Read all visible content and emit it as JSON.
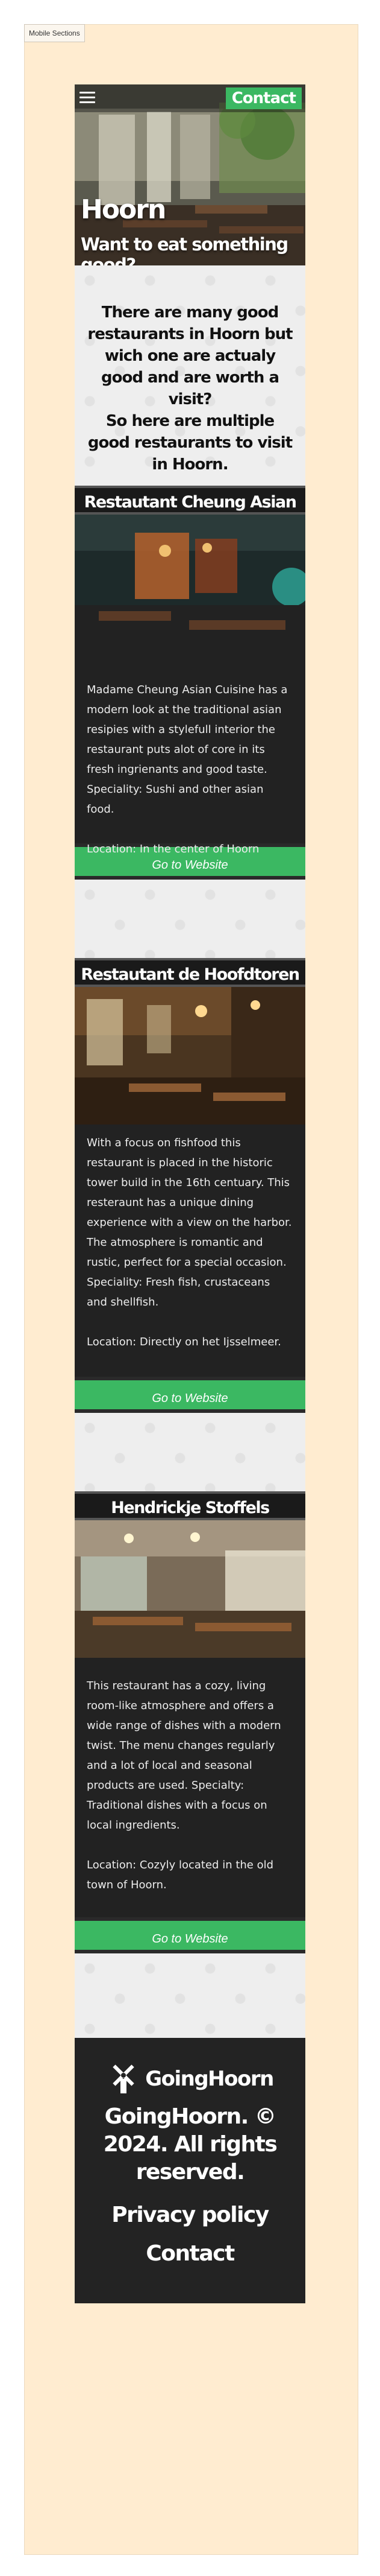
{
  "frame_label": "Mobile Sections",
  "header": {
    "contact_label": "Contact",
    "title": "Hoorn",
    "subtitle": "Want to eat something good?"
  },
  "intro": {
    "line1": "There are many good restaurants in Hoorn but wich one are actualy good and are worth a visit?",
    "line2": "So here are multiple good restaurants to visit in Hoorn."
  },
  "restaurants": [
    {
      "name": "Restautant Cheung Asian Cuisine",
      "description": "Madame Cheung Asian Cuisine has a modern look at the traditional asian resipies with a stylefull interior the restaurant puts alot of core in its fresh ingrienants and good taste. Speciality: Sushi and other asian food.",
      "location": "Location: In the center of Hoorn",
      "button": "Go to Website"
    },
    {
      "name": "Restautant de Hoofdtoren",
      "description": "With a focus on fishfood this restaurant is placed in the historic tower build in the 16th centuary. This resteraunt has a unique dining experience with a view on the harbor. The atmosphere is romantic and rustic, perfect for a special occasion. Speciality: Fresh fish, crustaceans and shellfish.",
      "location": "Location: Directly on het Ijsselmeer.",
      "button": "Go to Website"
    },
    {
      "name": "Hendrickje Stoffels",
      "description": "This restaurant has a cozy, living room-like atmosphere and offers a wide range of dishes with a modern twist. The menu changes regularly and a lot of local and seasonal products are used. Specialty: Traditional dishes with a focus on local ingredients.",
      "location": "Location: Cozyly located in the old town of Hoorn.",
      "button": "Go to Website"
    }
  ],
  "footer": {
    "logo_text": "GoingHoorn",
    "copyright": "GoingHoorn. © 2024. All rights reserved.",
    "privacy": "Privacy policy",
    "contact": "Contact"
  },
  "colors": {
    "accent": "#3bb862",
    "dark": "#222222",
    "frame": "#ffecd0"
  }
}
